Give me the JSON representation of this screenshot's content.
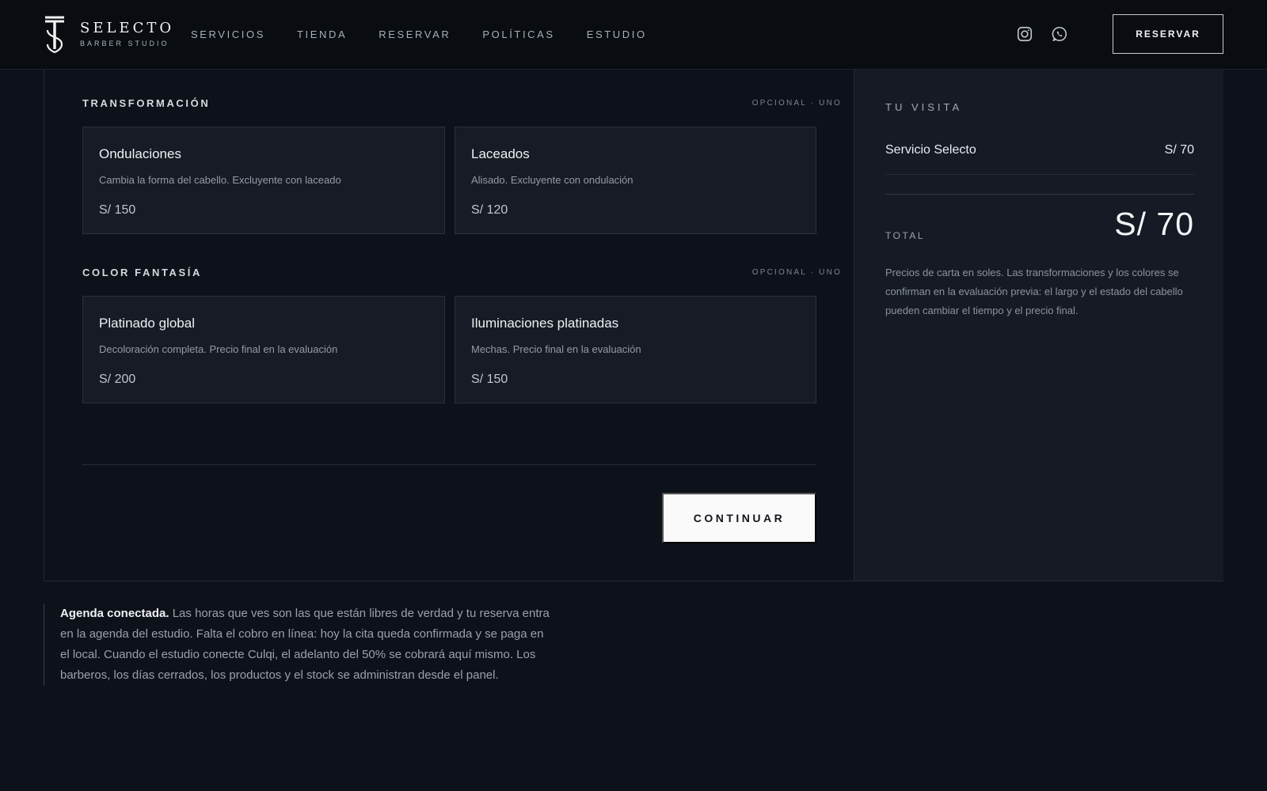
{
  "header": {
    "brand_name": "SELECTO",
    "brand_sub": "BARBER STUDIO",
    "nav": [
      "SERVICIOS",
      "TIENDA",
      "RESERVAR",
      "POLÍTICAS",
      "ESTUDIO"
    ],
    "social": [
      {
        "icon": "instagram-icon"
      },
      {
        "icon": "whatsapp-icon"
      }
    ],
    "cta_label": "RESERVAR"
  },
  "sections": [
    {
      "title": "TRANSFORMACIÓN",
      "tag": "OPCIONAL · UNO",
      "options": [
        {
          "title": "Ondulaciones",
          "desc": "Cambia la forma del cabello. Excluyente con laceado",
          "price": "S/ 150"
        },
        {
          "title": "Laceados",
          "desc": "Alisado. Excluyente con ondulación",
          "price": "S/ 120"
        }
      ]
    },
    {
      "title": "COLOR FANTASÍA",
      "tag": "OPCIONAL · UNO",
      "options": [
        {
          "title": "Platinado global",
          "desc": "Decoloración completa. Precio final en la evaluación",
          "price": "S/ 200"
        },
        {
          "title": "Iluminaciones platinadas",
          "desc": "Mechas. Precio final en la evaluación",
          "price": "S/ 150"
        }
      ]
    }
  ],
  "continue_label": "CONTINUAR",
  "summary": {
    "title": "TU VISITA",
    "items": [
      {
        "name": "Servicio Selecto",
        "price": "S/ 70"
      }
    ],
    "total_label": "TOTAL",
    "total_value": "S/ 70",
    "note": "Precios de carta en soles. Las transformaciones y los colores se confirman en la evaluación previa: el largo y el estado del cabello pueden cambiar el tiempo y el precio final."
  },
  "footer_note": {
    "lead": "Agenda conectada.",
    "text": " Las horas que ves son las que están libres de verdad y tu reserva entra en la agenda del estudio. Falta el cobro en línea: hoy la cita queda confirmada y se paga en el local. Cuando el estudio conecte Culqi, el adelanto del 50% se cobrará aquí mismo. Los barberos, los días cerrados, los productos y el stock se administran desde el panel."
  },
  "colors": {
    "background": "#0d1119",
    "header": "#090c11",
    "card": "#161b25",
    "summary_panel": "#151a24",
    "accent_button": "#fafafa"
  }
}
